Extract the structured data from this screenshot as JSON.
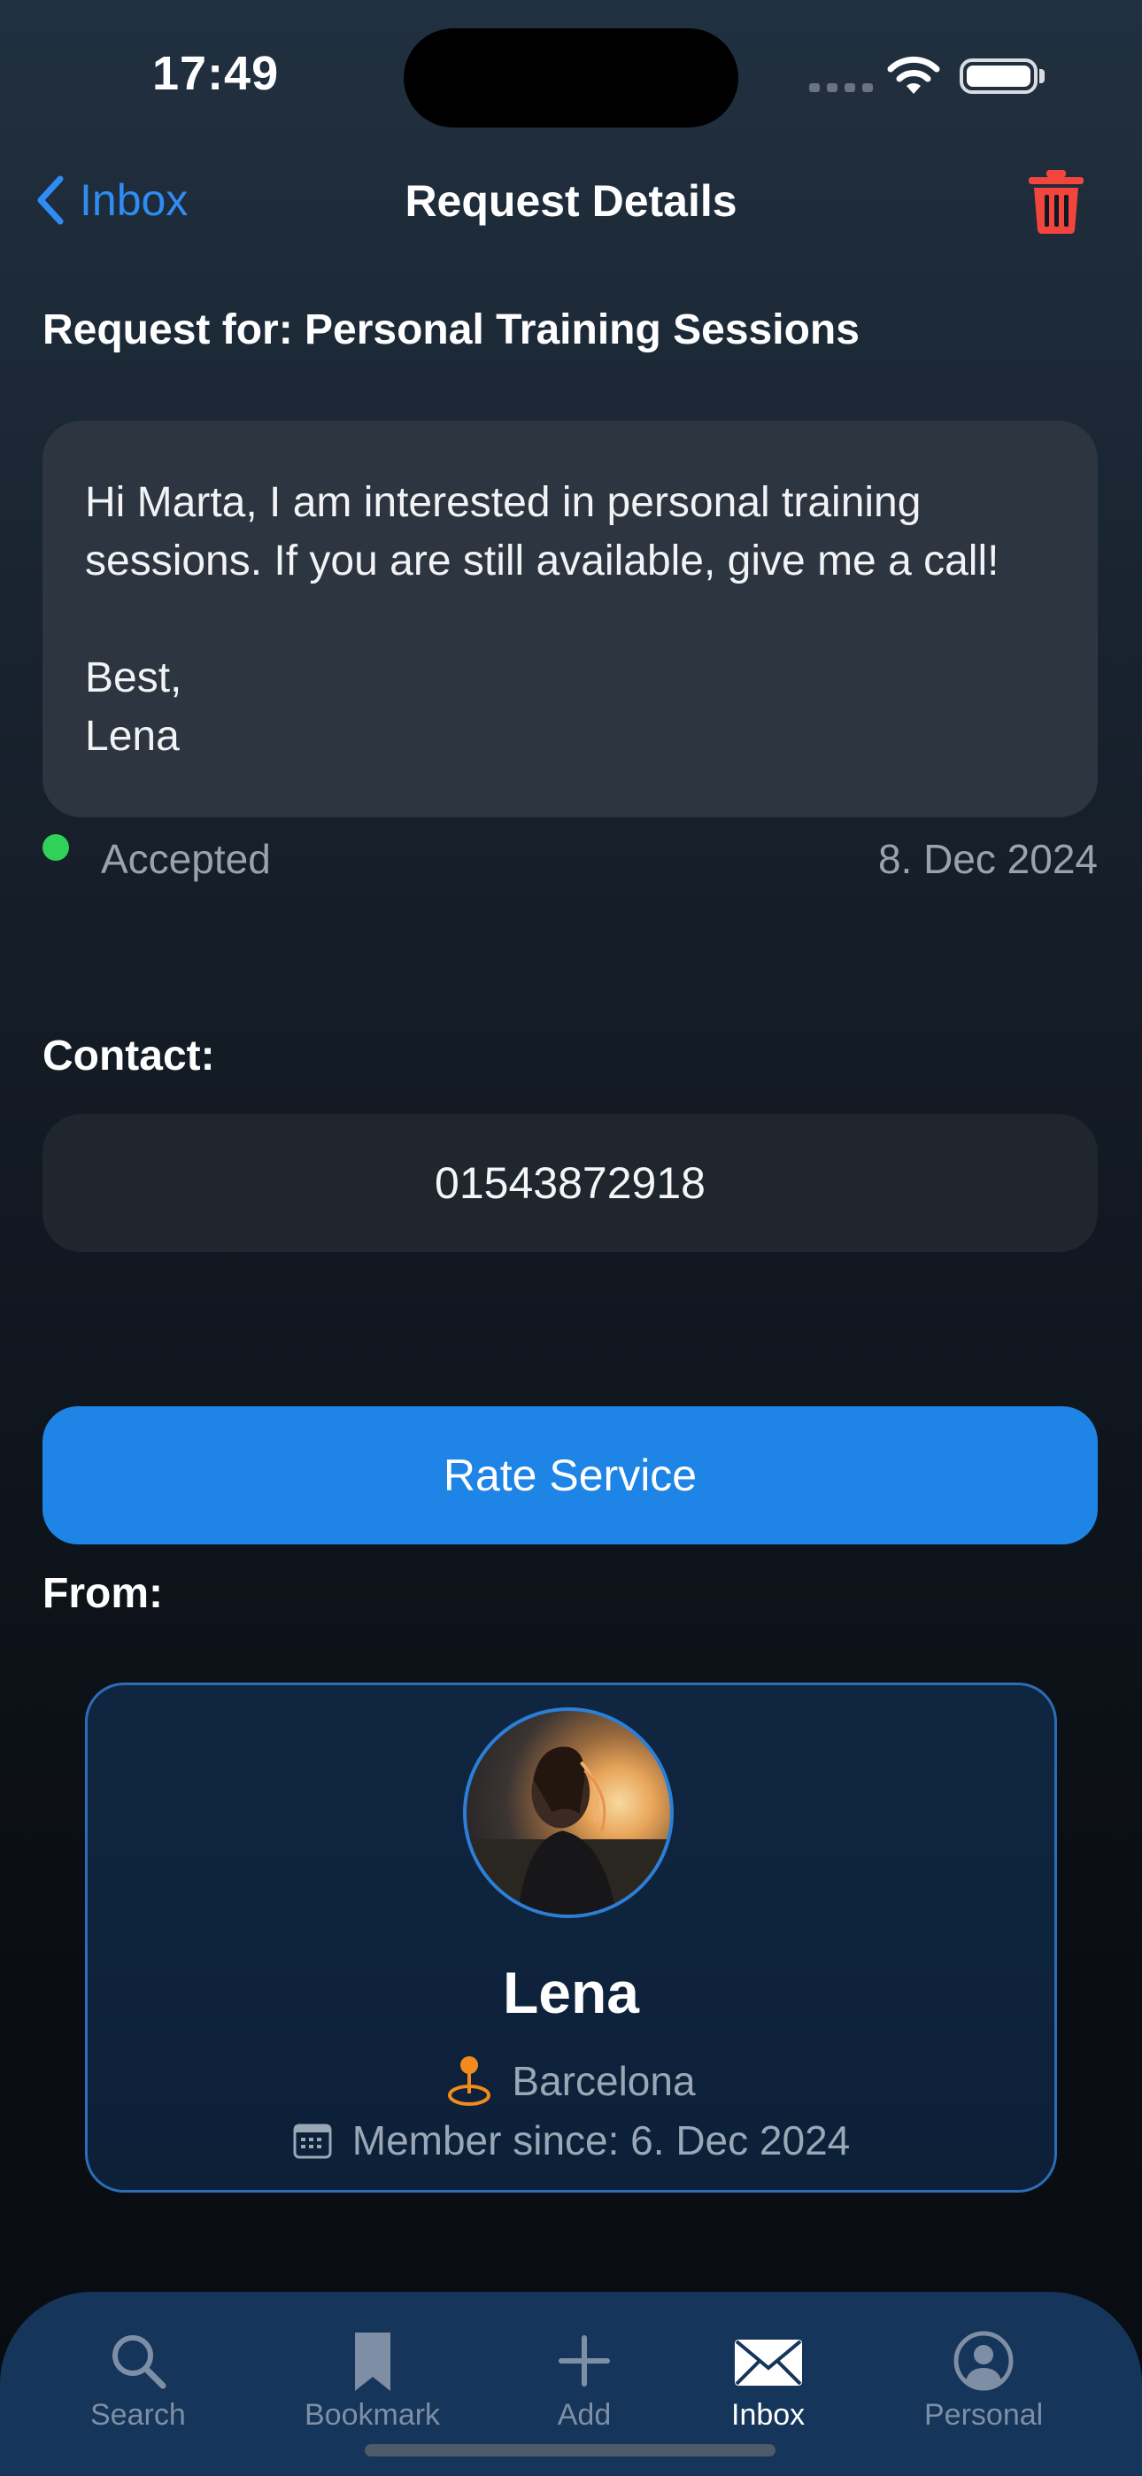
{
  "status_bar": {
    "time": "17:49"
  },
  "nav": {
    "back_label": "Inbox",
    "title": "Request Details",
    "delete_icon": "trash-icon"
  },
  "request": {
    "heading": "Request for: Personal Training Sessions",
    "message": "Hi Marta, I am interested in personal training sessions. If you are still available, give me a call!\n\nBest,\nLena",
    "status": "Accepted",
    "status_color": "#30d158",
    "date": "8. Dec 2024"
  },
  "contact": {
    "heading": "Contact:",
    "phone": "01543872918"
  },
  "rate_button": {
    "label": "Rate Service",
    "color": "#1e84e6"
  },
  "from": {
    "heading": "From:",
    "name": "Lena",
    "location": "Barcelona",
    "member_since": "Member since: 6. Dec 2024"
  },
  "tabbar": {
    "items": [
      {
        "label": "Search",
        "icon": "search-icon",
        "active": false
      },
      {
        "label": "Bookmark",
        "icon": "bookmark-icon",
        "active": false
      },
      {
        "label": "Add",
        "icon": "plus-icon",
        "active": false
      },
      {
        "label": "Inbox",
        "icon": "envelope-icon",
        "active": true
      },
      {
        "label": "Personal",
        "icon": "person-circle-icon",
        "active": false
      }
    ]
  }
}
